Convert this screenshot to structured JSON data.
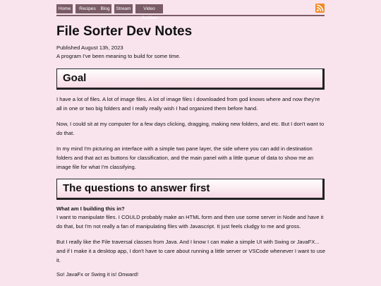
{
  "nav": {
    "items": [
      "Home",
      "Recipes",
      "Blog",
      "Stream",
      "Video Archive"
    ]
  },
  "rss": {
    "icon": "rss-icon",
    "color": "#f28a22"
  },
  "colors": {
    "background": "#f9e4ee",
    "nav": "#7a5c66"
  },
  "post": {
    "title": "File Sorter Dev Notes",
    "published": "Published August 13h, 2023",
    "subtitle": "A program I've been meaning to build for some time.",
    "sections": [
      {
        "heading": "Goal",
        "paragraphs": [
          "I have a lot of files. A lot of image files. A lot of image files I downloaded from god knows where and now they're all in one or two big folders and I really really wish I had organized them before hand.",
          "Now, I could sit at my computer for a few days clicking, dragging, making new folders, and etc. But I don't want to do that.",
          "In my mind I'm picturing an interface with a simple two pane layer, the side where you can add in destination folders and that act as buttons for classification, and the main panel with a little queue of data to show me an image file for what I'm classifying."
        ]
      },
      {
        "heading": "The questions to answer first",
        "question": "What am I building this in?",
        "paragraphs": [
          "I want to manipulate files. I COULD probably make an HTML form and then use some server in Node and have it do that, but I'm not really a fan of manipulating files with Javascript. It just feels cludgy to me and gross.",
          "But I really like the File traversal classes from Java. And I know I can make a simple UI with Swing or JavaFX... and if I make it a desktop app, I don't have to care about running a little server or VSCode whenever I want to use it.",
          "So! JavaFx or Swing it is! Onward!"
        ]
      }
    ]
  }
}
